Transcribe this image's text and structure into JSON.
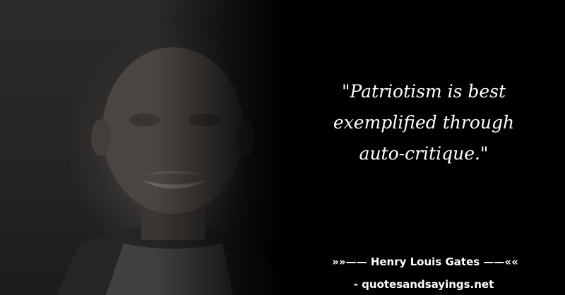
{
  "quote": {
    "line1": "\"Patriotism is best",
    "line2": "exemplified through",
    "line3": "auto-critique.\""
  },
  "attribution": "»»—— Henry Louis Gates ——««",
  "site": "- quotesandsayings.net",
  "colors": {
    "background": "#000000",
    "text": "#ffffff"
  }
}
